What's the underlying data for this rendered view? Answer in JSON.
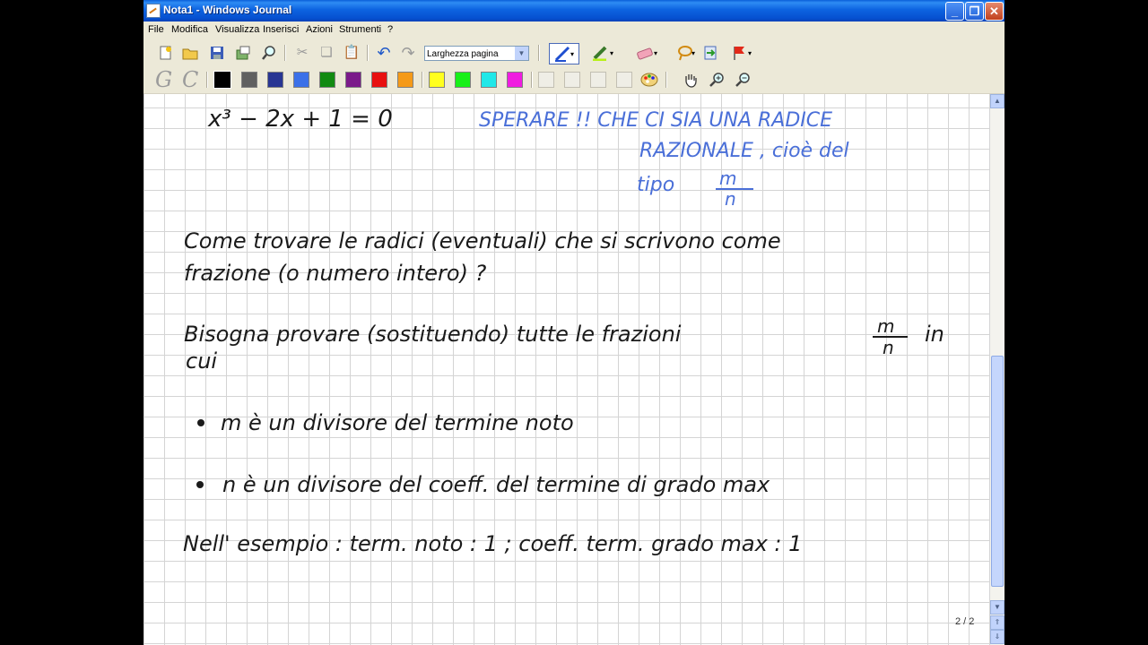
{
  "window": {
    "title": "Nota1 - Windows Journal",
    "min_symbol": "_",
    "max_symbol": "❐",
    "close_symbol": "✕"
  },
  "menu": [
    "File",
    "Modifica",
    "Visualizza",
    "Inserisci",
    "Azioni",
    "Strumenti",
    "?"
  ],
  "toolbar": {
    "zoom_select": "Larghezza pagina"
  },
  "colors": {
    "black": "#000000",
    "gray": "#606060",
    "navy": "#283593",
    "blue": "#3b70e8",
    "green": "#128a12",
    "purple": "#7b1a8a",
    "red": "#e81010",
    "orange": "#f59a18",
    "yellow": "#ffff1e",
    "lime": "#18f018",
    "cyan": "#20e8e8",
    "magenta": "#f01ce0",
    "ink_black": "#1a1a1a",
    "ink_blue": "#4a6fd8"
  },
  "icons": {
    "tb1": [
      "new-page-icon",
      "open-folder-icon",
      "save-icon",
      "send-icon",
      "find-icon",
      "cut-icon",
      "copy-icon",
      "paste-icon",
      "undo-icon",
      "redo-icon",
      "pen-icon",
      "highlighter-icon",
      "eraser-icon",
      "lasso-icon",
      "insert-space-icon",
      "flag-icon"
    ],
    "tb2": [
      "convert-g-icon",
      "convert-c-icon",
      "palette-icon",
      "hand-icon",
      "zoom-in-icon",
      "zoom-out-icon"
    ]
  },
  "note": {
    "equation": "x³ − 2x + 1 = 0",
    "blue_lines": [
      "SPERARE !! CHE CI SIA UNA RADICE",
      "RAZIONALE , cioè del",
      "tipo"
    ],
    "blue_fraction_num": "m",
    "blue_fraction_den": "n",
    "line1": "Come trovare le radici (eventuali) che si scrivono come",
    "line2": "frazione (o numero intero) ?",
    "line3": "Bisogna provare (sostituendo) tutte le frazioni",
    "frac_num": "m",
    "frac_den": "n",
    "line3_end": "in",
    "line4": "cui",
    "bullet1": "m è un divisore del termine noto",
    "bullet2": "n è un divisore del coeff. del termine di grado max",
    "line5": "Nell' esempio : term. noto : 1 ; coeff. term. grado max : 1"
  },
  "status": {
    "page_indicator": "2 / 2"
  }
}
